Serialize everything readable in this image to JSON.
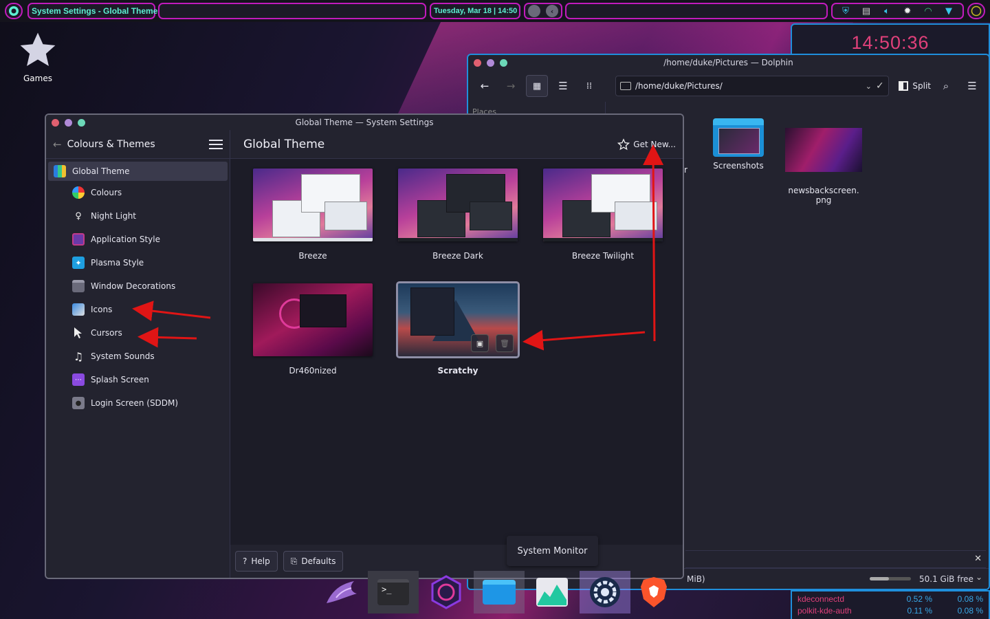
{
  "top_panel": {
    "active_window": "System Settings - Global Theme",
    "datetime": "Tuesday, Mar 18 | 14:50"
  },
  "desktop": {
    "icons": [
      {
        "label": "Games",
        "icon": "star-icon"
      }
    ]
  },
  "clock_widget": {
    "time": "14:50:36"
  },
  "dolphin": {
    "title": "/home/duke/Pictures — Dolphin",
    "path": "/home/duke/Pictures/",
    "split_label": "Split",
    "places_label": "Places",
    "files": [
      {
        "name": "Screenshots",
        "type": "folder"
      },
      {
        "name": "newsbackscreen.\npng",
        "type": "image"
      }
    ],
    "partial_label": "r",
    "status_partial": "MiB)",
    "free_space": "50.1 GiB free"
  },
  "settings": {
    "title": "Global Theme — System Settings",
    "sidebar_title": "Colours & Themes",
    "page_title": "Global Theme",
    "get_new": "Get New...",
    "nav": [
      {
        "label": "Global Theme",
        "icon": "global-theme-icon",
        "active": true
      },
      {
        "label": "Colours",
        "icon": "colours-icon"
      },
      {
        "label": "Night Light",
        "icon": "lightbulb-icon"
      },
      {
        "label": "Application Style",
        "icon": "application-style-icon"
      },
      {
        "label": "Plasma Style",
        "icon": "plasma-style-icon"
      },
      {
        "label": "Window Decorations",
        "icon": "window-decorations-icon"
      },
      {
        "label": "Icons",
        "icon": "icons-icon"
      },
      {
        "label": "Cursors",
        "icon": "cursor-icon"
      },
      {
        "label": "System Sounds",
        "icon": "music-note-icon"
      },
      {
        "label": "Splash Screen",
        "icon": "splash-screen-icon"
      },
      {
        "label": "Login Screen (SDDM)",
        "icon": "login-screen-icon"
      }
    ],
    "themes": [
      {
        "name": "Breeze",
        "style": "light"
      },
      {
        "name": "Breeze Dark",
        "style": "dark"
      },
      {
        "name": "Breeze Twilight",
        "style": "twilight"
      },
      {
        "name": "Dr460nized",
        "style": "dragon"
      },
      {
        "name": "Scratchy",
        "style": "mountain",
        "selected": true
      }
    ],
    "help_label": "Help",
    "defaults_label": "Defaults"
  },
  "tooltip": "System Monitor",
  "system_monitor": {
    "rows": [
      {
        "name": "kdeconnectd",
        "cpu": "0.52 %",
        "mem": "0.08 %"
      },
      {
        "name": "polkit-kde-auth",
        "cpu": "0.11 %",
        "mem": "0.08 %"
      }
    ]
  },
  "dock": [
    {
      "name": "dragon-launcher-icon"
    },
    {
      "name": "terminal-icon"
    },
    {
      "name": "garuda-icon"
    },
    {
      "name": "folder-icon"
    },
    {
      "name": "system-monitor-icon"
    },
    {
      "name": "system-settings-icon",
      "highlighted": true
    },
    {
      "name": "brave-browser-icon"
    }
  ],
  "colors": {
    "accent_magenta": "#c21bbd",
    "accent_teal": "#5cf0d2",
    "accent_blue": "#1f8fdc",
    "clock_pink": "#e0407a",
    "annotation_red": "#e01515"
  }
}
